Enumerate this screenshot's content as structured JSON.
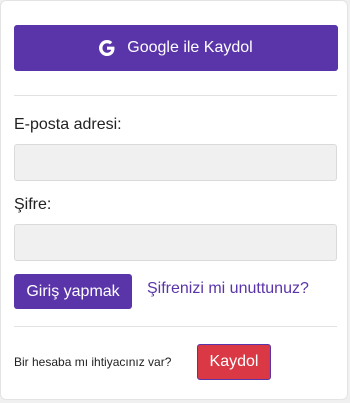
{
  "google_signup": {
    "label": "Google ile Kaydol",
    "icon": "google-icon"
  },
  "login_form": {
    "email_label": "E-posta adresi:",
    "email_value": "",
    "password_label": "Şifre:",
    "password_value": "",
    "login_button": "Giriş yapmak",
    "forgot_link": "Şifrenizi mi unuttunuz?"
  },
  "signup_prompt": {
    "text": "Bir hesaba mı ihtiyacınız var?",
    "button": "Kaydol"
  },
  "colors": {
    "primary": "#5a35a9",
    "danger": "#d93844",
    "input_bg": "#f0f0f0"
  }
}
